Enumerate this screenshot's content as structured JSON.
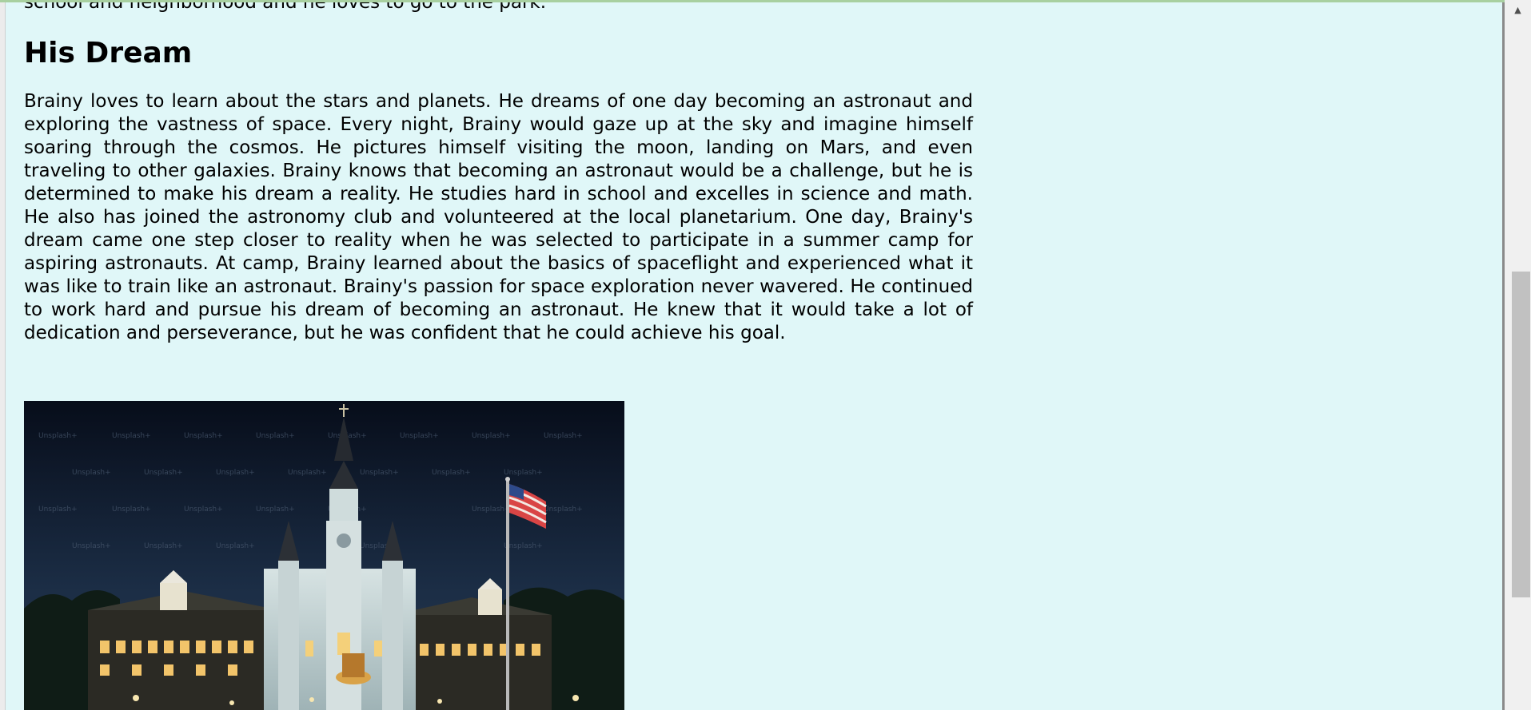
{
  "intro_tail": "school and neighborhood and he loves to go to the park.",
  "section": {
    "heading": "His Dream",
    "paragraph": "Brainy loves to learn about the stars and planets. He dreams of one day becoming an astronaut and exploring the vastness of space. Every night, Brainy would gaze up at the sky and imagine himself soaring through the cosmos. He pictures himself visiting the moon, landing on Mars, and even traveling to other galaxies. Brainy knows that becoming an astronaut would be a challenge, but he is determined to make his dream a reality. He studies hard in school and excelles in science and math. He also has joined the astronomy club and volunteered at the local planetarium. One day, Brainy's dream came one step closer to reality when he was selected to participate in a summer camp for aspiring astronauts. At camp, Brainy learned about the basics of spaceflight and experienced what it was like to train like an astronaut. Brainy's passion for space exploration never wavered. He continued to work hard and pursue his dream of becoming an astronaut. He knew that it would take a lot of dedication and perseverance, but he was confident that he could achieve his goal."
  },
  "image": {
    "subject": "cathedral at night with illuminated buildings and a flag on a pole",
    "watermark": "Unsplash+"
  },
  "colors": {
    "page_background": "#e0f7f8",
    "text": "#000000",
    "scrollbar_track": "#f0f0f0",
    "scrollbar_thumb": "#c1c1c1"
  },
  "scrollbar": {
    "up_arrow_icon": "chevron-up-icon"
  }
}
